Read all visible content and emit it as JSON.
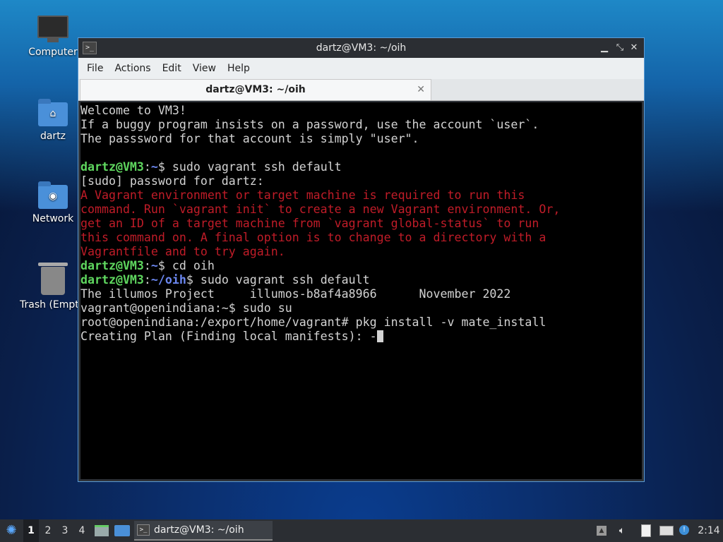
{
  "desktop": {
    "icons": [
      {
        "label": "Computer"
      },
      {
        "label": "dartz"
      },
      {
        "label": "Network"
      },
      {
        "label": "Trash (Empt"
      }
    ]
  },
  "window": {
    "title": "dartz@VM3: ~/oih",
    "app_icon": ">_",
    "controls": {
      "minimize": "▁",
      "maximize": "⤡",
      "close": "✕"
    },
    "menu": [
      "File",
      "Actions",
      "Edit",
      "View",
      "Help"
    ],
    "tab": {
      "label": "dartz@VM3: ~/oih",
      "close": "✕"
    }
  },
  "terminal": {
    "welcome": [
      "Welcome to VM3!",
      "If a buggy program insists on a password, use the account `user`.",
      "The passsword for that account is simply \"user\"."
    ],
    "prompt1": {
      "user": "dartz@VM3",
      "colon": ":",
      "path": "~",
      "cmd": "$ sudo vagrant ssh default"
    },
    "sudo_prompt": "[sudo] password for dartz:",
    "error": [
      "A Vagrant environment or target machine is required to run this",
      "command. Run `vagrant init` to create a new Vagrant environment. Or,",
      "get an ID of a target machine from `vagrant global-status` to run",
      "this command on. A final option is to change to a directory with a",
      "Vagrantfile and to try again."
    ],
    "prompt2": {
      "user": "dartz@VM3",
      "colon": ":",
      "path": "~",
      "cmd": "$ cd oih"
    },
    "prompt3": {
      "user": "dartz@VM3",
      "colon": ":",
      "path": "~/oih",
      "cmd": "$ sudo vagrant ssh default"
    },
    "output": [
      "The illumos Project     illumos-b8af4a8966      November 2022",
      "vagrant@openindiana:~$ sudo su",
      "root@openindiana:/export/home/vagrant# pkg install -v mate_install",
      "Creating Plan (Finding local manifests): -"
    ]
  },
  "taskbar": {
    "start_icon": "start-menu-icon",
    "workspaces": [
      "1",
      "2",
      "3",
      "4"
    ],
    "task_label": "dartz@VM3: ~/oih",
    "clock": "2:14"
  }
}
